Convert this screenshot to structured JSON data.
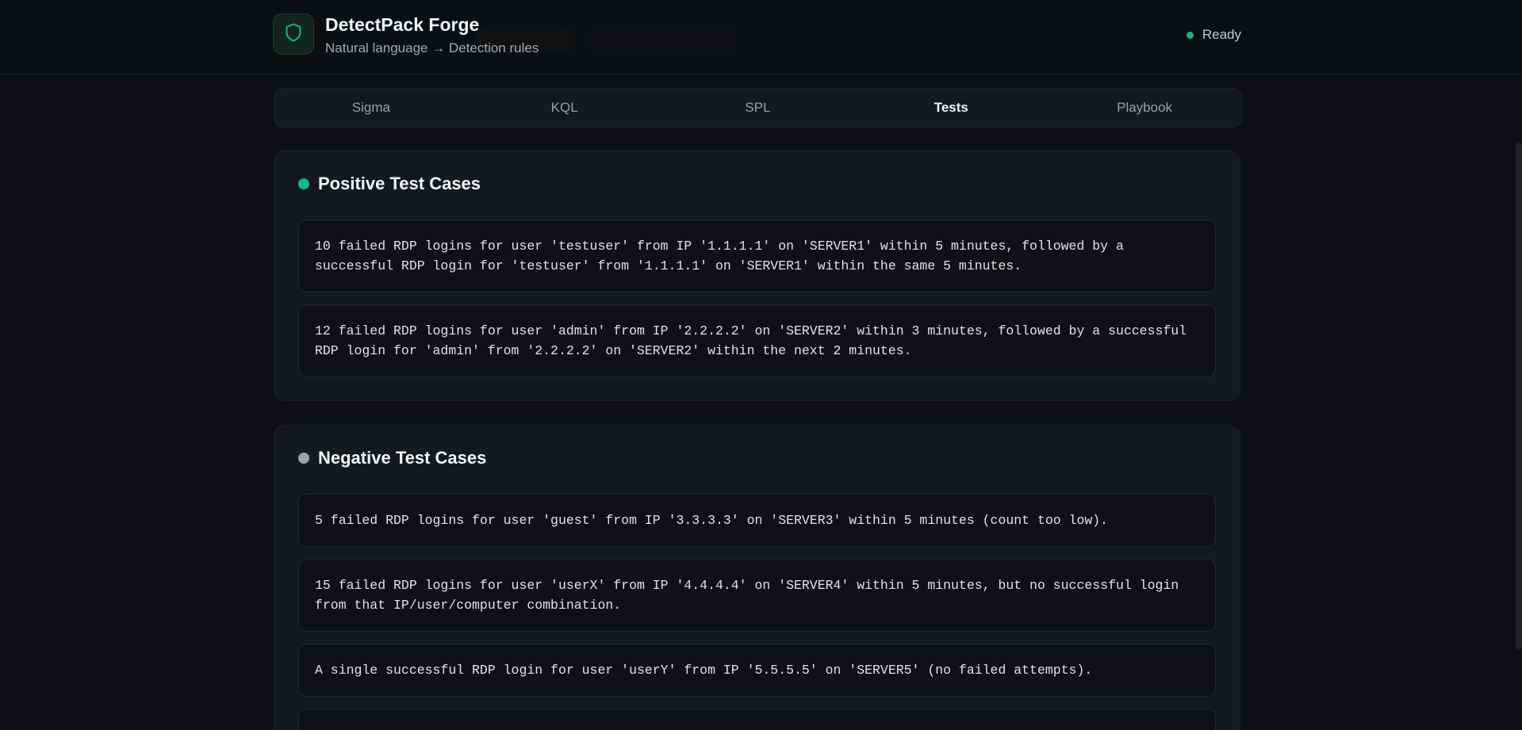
{
  "app": {
    "title": "DetectPack Forge",
    "subtitle": "Natural language → Detection rules",
    "status": "Ready"
  },
  "colors": {
    "accent": "#10b981",
    "neutral": "#9ca3af",
    "background": "#0d0f12",
    "panel": "#15181d"
  },
  "icons": {
    "logo": "shield-icon"
  },
  "tabs": [
    {
      "label": "Sigma",
      "active": false
    },
    {
      "label": "KQL",
      "active": false
    },
    {
      "label": "SPL",
      "active": false
    },
    {
      "label": "Tests",
      "active": true
    },
    {
      "label": "Playbook",
      "active": false
    }
  ],
  "positive": {
    "title": "Positive Test Cases",
    "cases": [
      "10 failed RDP logins for user 'testuser' from IP '1.1.1.1' on 'SERVER1' within 5 minutes, followed by a successful RDP login for 'testuser' from '1.1.1.1' on 'SERVER1' within the same 5 minutes.",
      "12 failed RDP logins for user 'admin' from IP '2.2.2.2' on 'SERVER2' within 3 minutes, followed by a successful RDP login for 'admin' from '2.2.2.2' on 'SERVER2' within the next 2 minutes."
    ]
  },
  "negative": {
    "title": "Negative Test Cases",
    "cases": [
      "5 failed RDP logins for user 'guest' from IP '3.3.3.3' on 'SERVER3' within 5 minutes (count too low).",
      "15 failed RDP logins for user 'userX' from IP '4.4.4.4' on 'SERVER4' within 5 minutes, but no successful login from that IP/user/computer combination.",
      "A single successful RDP login for user 'userY' from IP '5.5.5.5' on 'SERVER5' (no failed attempts)."
    ]
  }
}
